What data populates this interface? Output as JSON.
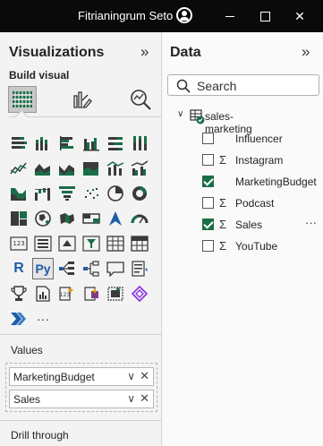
{
  "titlebar": {
    "user_name": "Fitrianingrum Seto",
    "avatar_icon": "person-circle-icon",
    "minimize_icon": "minimize-icon",
    "maximize_icon": "maximize-icon",
    "close_icon": "close-icon",
    "close_glyph": "✕"
  },
  "visualizations": {
    "title": "Visualizations",
    "collapse_glyph": "»",
    "build_visual_label": "Build visual",
    "build_icons": [
      "build-visual-icon",
      "format-visual-icon",
      "analytics-icon"
    ],
    "selected_build_tab": "build-visual-icon",
    "gallery": [
      "stacked-bar-chart-icon",
      "stacked-column-chart-icon",
      "clustered-bar-chart-icon",
      "clustered-column-chart-icon",
      "100-stacked-bar-chart-icon",
      "100-stacked-column-chart-icon",
      "line-chart-icon",
      "area-chart-icon",
      "stacked-area-chart-icon",
      "100-stacked-area-chart-icon",
      "line-and-stacked-column-icon",
      "line-and-clustered-column-icon",
      "ribbon-chart-icon",
      "waterfall-chart-icon",
      "funnel-chart-icon",
      "scatter-chart-icon",
      "pie-chart-icon",
      "donut-chart-icon",
      "treemap-icon",
      "map-icon",
      "filled-map-icon",
      "shape-map-icon",
      "azure-map-icon",
      "gauge-icon",
      "card-icon",
      "multi-row-card-icon",
      "kpi-icon",
      "slicer-icon",
      "table-icon",
      "matrix-icon",
      "r-visual-icon",
      "python-visual-icon",
      "key-influencers-icon",
      "decomposition-tree-icon",
      "qa-icon",
      "smart-narrative-icon",
      "trophy-goals-icon",
      "paginated-report-icon",
      "new-card-icon",
      "power-apps-icon",
      "power-automate-icon",
      "get-more-visuals-icon",
      "power-automate-flow-icon",
      "more-options-icon"
    ],
    "selected_visual": "python-visual-icon",
    "values_label": "Values",
    "values": [
      {
        "label": "MarketingBudget"
      },
      {
        "label": "Sales"
      }
    ],
    "drill_through_label": "Drill through",
    "r_glyph": "R",
    "py_glyph": "Py",
    "more_glyph": "···",
    "chevron_glyph": "∨",
    "remove_glyph": "✕"
  },
  "data": {
    "title": "Data",
    "collapse_glyph": "»",
    "search_placeholder": "Search",
    "table_name": "sales-marketing",
    "expand_glyph": "∨",
    "sigma_glyph": "Σ",
    "more_glyph": "···",
    "fields": [
      {
        "name": "Influencer",
        "checked": false,
        "sigma": false
      },
      {
        "name": "Instagram",
        "checked": false,
        "sigma": true
      },
      {
        "name": "MarketingBudget",
        "checked": true,
        "sigma": false
      },
      {
        "name": "Podcast",
        "checked": false,
        "sigma": true
      },
      {
        "name": "Sales",
        "checked": true,
        "sigma": true,
        "more": true
      },
      {
        "name": "YouTube",
        "checked": false,
        "sigma": true
      }
    ],
    "accent_color": "#1a6e47"
  }
}
